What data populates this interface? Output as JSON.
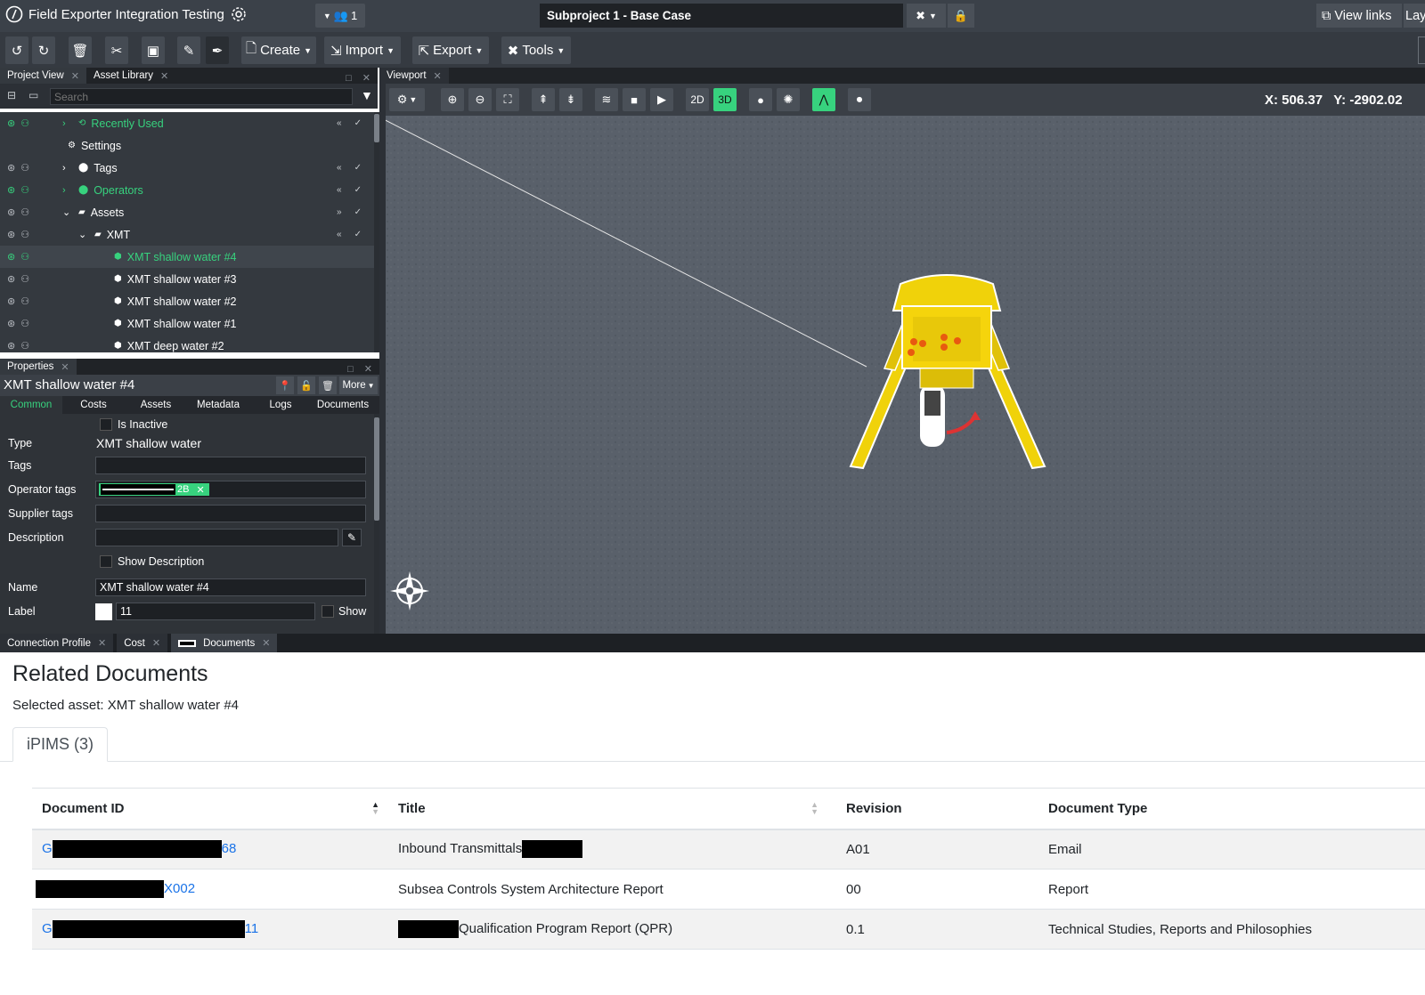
{
  "app": {
    "title": "Field Exporter Integration Testing",
    "project_selector": "Subproject 1 - Base Case",
    "users_count": "1",
    "view_links": "View links",
    "layout_partial": "Lay"
  },
  "toolbar": {
    "create": "Create",
    "import": "Import",
    "export": "Export",
    "tools": "Tools"
  },
  "project_panel": {
    "tabs": [
      "Project View",
      "Asset Library"
    ],
    "search_placeholder": "Search",
    "rows": [
      {
        "label": "Recently Used",
        "green": true,
        "expand": ">",
        "icon": "history-icon"
      },
      {
        "label": "Settings",
        "green": false,
        "expand": "",
        "icon": "gear-icon"
      },
      {
        "label": "Tags",
        "green": false,
        "expand": ">",
        "icon": "tag-icon"
      },
      {
        "label": "Operators",
        "green": true,
        "expand": ">",
        "icon": "tag-icon"
      },
      {
        "label": "Assets",
        "green": false,
        "expand": "v",
        "icon": "folder-icon"
      },
      {
        "label": "XMT",
        "green": false,
        "expand": "v",
        "icon": "folder-icon"
      },
      {
        "label": "XMT shallow water #4",
        "green": true,
        "expand": "",
        "icon": "cube-icon"
      },
      {
        "label": "XMT shallow water #3",
        "green": false,
        "expand": "",
        "icon": "cube-icon"
      },
      {
        "label": "XMT shallow water #2",
        "green": false,
        "expand": "",
        "icon": "cube-icon"
      },
      {
        "label": "XMT shallow water #1",
        "green": false,
        "expand": "",
        "icon": "cube-icon"
      },
      {
        "label": "XMT deep water #2",
        "green": false,
        "expand": "",
        "icon": "cube-icon"
      }
    ]
  },
  "properties": {
    "tab": "Properties",
    "title": "XMT shallow water #4",
    "more": "More",
    "subtabs": [
      "Common",
      "Costs",
      "Assets",
      "Metadata",
      "Logs",
      "Documents"
    ],
    "is_inactive": "Is Inactive",
    "type_label": "Type",
    "type_value": "XMT shallow water",
    "tags_label": "Tags",
    "operator_tags_label": "Operator tags",
    "operator_tag_suffix": "2B",
    "supplier_tags_label": "Supplier tags",
    "description_label": "Description",
    "show_description": "Show Description",
    "name_label": "Name",
    "name_value": "XMT shallow water #4",
    "label_label": "Label",
    "label_value": "11",
    "show": "Show"
  },
  "viewport": {
    "tab": "Viewport",
    "btn_2d": "2D",
    "btn_3d": "3D",
    "coords": "X: 506.37   Y: -2902.02"
  },
  "bottom_tabs": [
    "Connection Profile",
    "Cost",
    "Documents"
  ],
  "documents": {
    "heading": "Related Documents",
    "selected_asset": "Selected asset: XMT shallow water #4",
    "tab": "iPIMS (3)",
    "columns": [
      "Document ID",
      "Title",
      "Revision",
      "Document Type"
    ],
    "rows": [
      {
        "id_prefix": "G",
        "id_suffix": "68",
        "title_prefix": "",
        "title": "Inbound Transmittals",
        "revision": "A01",
        "type": "Email"
      },
      {
        "id_prefix": "",
        "id_suffix": "X002",
        "title_prefix": "",
        "title": "Subsea Controls System Architecture Report",
        "revision": "00",
        "type": "Report"
      },
      {
        "id_prefix": "G",
        "id_suffix": "11",
        "title_prefix": "",
        "title": "Qualification Program Report (QPR)",
        "revision": "0.1",
        "type": "Technical Studies, Reports and Philosophies"
      }
    ]
  },
  "colors": {
    "accent": "#37d27e",
    "link": "#1a73e8",
    "asset_yellow": "#f0d20a"
  }
}
